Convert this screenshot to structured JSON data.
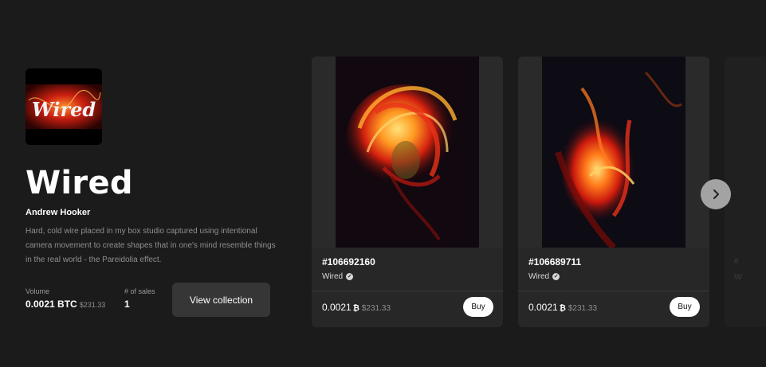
{
  "collection": {
    "logo_text": "Wired",
    "title": "Wired",
    "artist": "Andrew Hooker",
    "description": "Hard, cold wire placed in my box studio captured using intentional camera movement to create shapes that in one's mind resemble things in the real world - the Pareidolia effect.",
    "volume_label": "Volume",
    "volume_btc": "0.0021 BTC",
    "volume_usd": "$231.33",
    "sales_label": "# of sales",
    "sales_value": "1",
    "view_button": "View collection"
  },
  "cards": [
    {
      "token": "#106692160",
      "collection": "Wired",
      "price": "0.0021",
      "currency_icon": "₿",
      "usd": "$231.33",
      "buy_label": "Buy"
    },
    {
      "token": "#106689711",
      "collection": "Wired",
      "price": "0.0021",
      "currency_icon": "₿",
      "usd": "$231.33",
      "buy_label": "Buy"
    }
  ],
  "carousel": {
    "next_icon": "chevron-right-icon"
  },
  "colors": {
    "background": "#1b1b1b",
    "card": "#272727",
    "button": "#363636",
    "accent_fire": "#e8341a"
  }
}
